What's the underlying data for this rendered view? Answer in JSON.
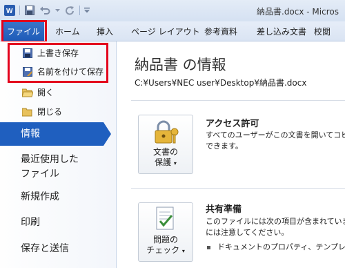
{
  "titlebar": {
    "app_icon": "word-icon",
    "save_icon": "save-icon",
    "undo_icon": "undo-icon",
    "redo_icon": "redo-icon",
    "customize_icon": "customize-qat-icon",
    "document_title": "納品書.docx - Micros"
  },
  "ribbon": {
    "tabs": [
      "ファイル",
      "ホーム",
      "挿入",
      "ページ レイアウト",
      "参考資料",
      "差し込み文書",
      "校閲"
    ]
  },
  "backstage": {
    "save_label": "上書き保存",
    "save_as_label": "名前を付けて保存",
    "open_label": "開く",
    "close_label": "閉じる",
    "info_label": "情報",
    "recent_label_1": "最近使用した",
    "recent_label_2": "ファイル",
    "new_label": "新規作成",
    "print_label": "印刷",
    "save_send_label": "保存と送信"
  },
  "info": {
    "title": "納品書 の情報",
    "path": "C:¥Users¥NEC user¥Desktop¥納品書.docx",
    "protect": {
      "button_line1": "文書の",
      "button_line2": "保護",
      "heading": "アクセス許可",
      "text_1": "すべてのユーザーがこの文書を開いてコピ",
      "text_2": "できます。"
    },
    "check": {
      "button_line1": "問題の",
      "button_line2": "チェック",
      "heading": "共有準備",
      "text_1": "このファイルには次の項目が含まれていま",
      "text_2": "には注意してください。",
      "bullet_1": "ドキュメントのプロパティ、テンプレー"
    }
  },
  "colors": {
    "accent": "#1f5fbf",
    "highlight_box": "#e3001b"
  }
}
